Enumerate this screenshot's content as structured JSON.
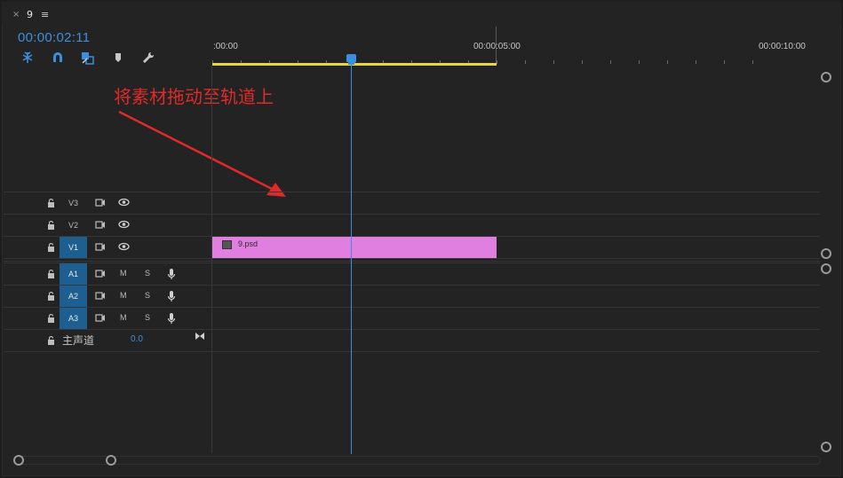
{
  "panel": {
    "close_glyph": "×",
    "sequence_name": "9",
    "menu_glyph": "≡"
  },
  "timecode": "00:00:02:11",
  "tools": [
    {
      "name": "snap-insert-nest-icon"
    },
    {
      "name": "magnet-snap-icon"
    },
    {
      "name": "linked-selection-icon"
    },
    {
      "name": "add-marker-icon"
    },
    {
      "name": "wrench-settings-icon"
    }
  ],
  "ruler": {
    "labels": [
      ":00:00",
      "00:00:05:00",
      "00:00:10:00"
    ]
  },
  "annotation": "将素材拖动至轨道上",
  "video_tracks": [
    {
      "label": "V3",
      "targeted": false
    },
    {
      "label": "V2",
      "targeted": false
    },
    {
      "label": "V1",
      "targeted": true
    }
  ],
  "audio_tracks": [
    {
      "label": "A1",
      "m": "M",
      "s": "S"
    },
    {
      "label": "A2",
      "m": "M",
      "s": "S"
    },
    {
      "label": "A3",
      "m": "M",
      "s": "S"
    }
  ],
  "master": {
    "label": "主声道",
    "value": "0.0"
  },
  "clip": {
    "name": "9.psd",
    "track": "V1",
    "color": "#e07fe0"
  },
  "colors": {
    "accent": "#3b8fe0",
    "annotation": "#e02a2a",
    "work_area": "#e6d44a",
    "track_target": "#1c5f90"
  }
}
